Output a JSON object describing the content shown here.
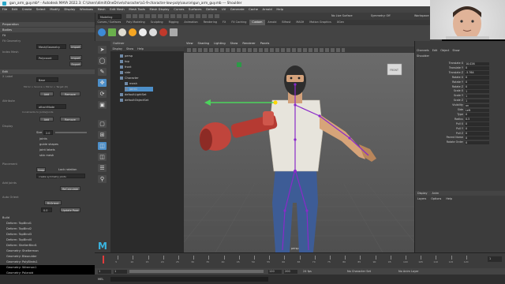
{
  "window": {
    "title": "gun_arm_guy.mb* - Autodesk MAYA 2022.3: C:\\Users\\dimit\\OneDrive\\character\\a1-9-character-low-poly\\source\\gun_arm_guy.mb --- Shoulder"
  },
  "menubar": [
    "File",
    "Edit",
    "Create",
    "Select",
    "Modify",
    "Display",
    "Windows",
    "Mesh",
    "Edit Mesh",
    "Mesh Tools",
    "Mesh Display",
    "Curves",
    "Surfaces",
    "Deform",
    "UV",
    "Generate",
    "Cache",
    "Arnold",
    "Help"
  ],
  "status": {
    "workspace_label": "Workspace",
    "mode": "Modeling",
    "no_live_surface": "No Live Surface",
    "symmetry": "Symmetry: Off"
  },
  "shelf_tabs": [
    "Curves / Surfaces",
    "Poly Modeling",
    "Sculpting",
    "Rigging",
    "Animation",
    "Rendering",
    "FX",
    "FX Caching",
    "Custom",
    "Arnold",
    "Bifrost",
    "MASH",
    "Motion Graphics",
    "XGen"
  ],
  "shelf_active": "Custom",
  "left_panel": {
    "tabs": [
      "Preparation",
      "Bodies"
    ],
    "section_fit": "Fit",
    "fit_geometry_label": "Fit Geometry",
    "mesh_dropdown": "Mesh/Geometry",
    "import_label": "Import",
    "index_label": "Index Mesh",
    "poly_dropdown": "Polycount",
    "export_label": "Export",
    "section_edit": "Edit",
    "x_label": "X Label",
    "scale_dropdown": "Base",
    "mirror_hint": "Mirror > Source > Mirror > Target (R)",
    "add_label": "Add",
    "remove_label": "Remove",
    "attribute_label": "Attribute",
    "attr_dropdown": "attachMode",
    "constraints_hint": "Constraints to Joints/Joints",
    "display_label": "Display",
    "size_label": "Size",
    "size_value": "2.0",
    "options": [
      "joints",
      "guide shapes",
      "joint labels",
      "skin mesh"
    ],
    "placement_label": "Placement",
    "lock_label": "Lock rotation",
    "snap_label": "Snap",
    "symmetry_label": "create symmetry joints",
    "add_joints_label": "Add Joints",
    "freeze_label": "ReCalculate",
    "auto_orient_label": "Auto Orient",
    "orient_btn": "FitOrient",
    "orient_value": "0.0",
    "build_pose_btn": "Update Pose",
    "bottom_items": [
      "Build",
      "Deform: TopBind1",
      "Deform: TopBind2",
      "Deform: TopBind3",
      "Deform: TopBind4",
      "Deform: ShelterBind1",
      "Geometry: Shelterman",
      "Geometry: BIssoulder",
      "Geometry: PolyBinds1",
      "Geometry: Wireman1",
      "Geometry: Polaroid"
    ],
    "go_to_build": "Go to Build Pose"
  },
  "outliner": {
    "title": "Outliner",
    "menu": [
      "Display",
      "Show",
      "Help"
    ],
    "items": [
      "persp",
      "top",
      "front",
      "side",
      "Character",
      "mesh",
      "joint1",
      "defaultLightSet",
      "defaultObjectSet"
    ]
  },
  "viewport": {
    "menu": [
      "View",
      "Shading",
      "Lighting",
      "Show",
      "Renderer",
      "Panels"
    ],
    "camera_label": "persp",
    "cube_label": "FRONT"
  },
  "attribute_editor": {
    "tabs": [
      "Channels",
      "Edit",
      "Object",
      "Show"
    ],
    "node_name": "Shoulder",
    "channels": [
      {
        "name": "Translate X",
        "value": "10.026"
      },
      {
        "name": "Translate Y",
        "value": "0"
      },
      {
        "name": "Translate Z",
        "value": "-5.764"
      },
      {
        "name": "Rotate X",
        "value": "0"
      },
      {
        "name": "Rotate Y",
        "value": "0"
      },
      {
        "name": "Rotate Z",
        "value": "0"
      },
      {
        "name": "Scale X",
        "value": "1"
      },
      {
        "name": "Scale Y",
        "value": "1"
      },
      {
        "name": "Scale Z",
        "value": "1"
      },
      {
        "name": "Visibility",
        "value": "on"
      },
      {
        "name": "Side",
        "value": "Left"
      },
      {
        "name": "Type",
        "value": "0"
      },
      {
        "name": "Radius",
        "value": "0.5"
      },
      {
        "name": "Pull X",
        "value": "0"
      },
      {
        "name": "Pull Y",
        "value": "0"
      },
      {
        "name": "Pull Z",
        "value": "0"
      },
      {
        "name": "Parent Name",
        "value": "0"
      },
      {
        "name": "Rotate Order",
        "value": "0"
      }
    ],
    "lower_tabs": [
      "Display",
      "Anim"
    ],
    "lower_menu": [
      "Layers",
      "Options",
      "Help"
    ]
  },
  "timeline": {
    "ticks": [
      "5",
      "10",
      "15",
      "20",
      "25",
      "30",
      "35",
      "40",
      "45",
      "50",
      "55",
      "60",
      "65",
      "70",
      "75",
      "80",
      "85",
      "90",
      "95",
      "100",
      "105",
      "110",
      "115",
      "120"
    ],
    "current_frame": "1"
  },
  "range": {
    "start": "1",
    "end": "120",
    "anim_end": "200",
    "fps": "24 fps",
    "no_char_set": "No Character Set",
    "no_anim_layer": "No Anim Layer"
  },
  "helpline": {
    "mel_label": "MEL",
    "command": ""
  },
  "colors": {
    "accent": "#4d8fc9",
    "joint": "#8a2ac9",
    "shirt": "#e7e4dc",
    "jeans": "#3d5c96",
    "gun": "#b53a32"
  }
}
